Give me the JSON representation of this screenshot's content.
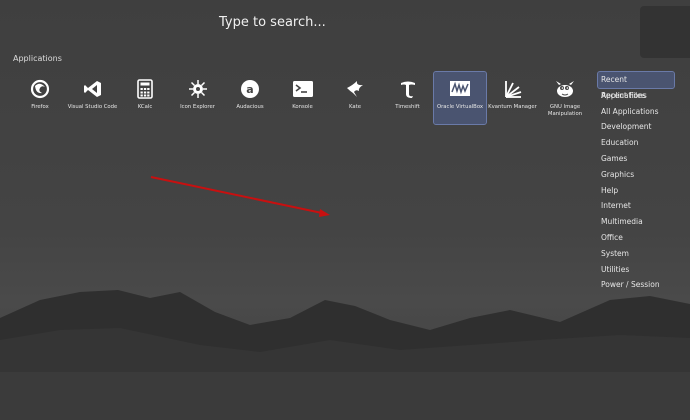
{
  "search": {
    "placeholder": "Type to search..."
  },
  "applications_title": "Applications",
  "apps": [
    {
      "label": "Firefox",
      "icon": "firefox-icon"
    },
    {
      "label": "Visual Studio Code",
      "icon": "vscode-icon"
    },
    {
      "label": "KCalc",
      "icon": "calculator-icon"
    },
    {
      "label": "Icon Explorer",
      "icon": "icon-explorer-icon"
    },
    {
      "label": "Audacious",
      "icon": "audacious-icon"
    },
    {
      "label": "Konsole",
      "icon": "terminal-icon"
    },
    {
      "label": "Kate",
      "icon": "kate-icon"
    },
    {
      "label": "Timeshift",
      "icon": "timeshift-icon"
    },
    {
      "label": "Oracle VirtualBox",
      "icon": "virtualbox-icon",
      "selected": true
    },
    {
      "label": "Kvantum Manager",
      "icon": "kvantum-icon"
    },
    {
      "label": "GNU Image Manipulation",
      "icon": "gimp-icon"
    }
  ],
  "categories": [
    {
      "label": "Recent Applications",
      "active": true
    },
    {
      "label": "Recent Files"
    },
    {
      "label": "All Applications"
    },
    {
      "label": "Development"
    },
    {
      "label": "Education"
    },
    {
      "label": "Games"
    },
    {
      "label": "Graphics"
    },
    {
      "label": "Help"
    },
    {
      "label": "Internet"
    },
    {
      "label": "Multimedia"
    },
    {
      "label": "Office"
    },
    {
      "label": "System"
    },
    {
      "label": "Utilities"
    },
    {
      "label": "Power / Session"
    }
  ],
  "colors": {
    "selection": "#4a5470",
    "arrow": "#d01010"
  }
}
